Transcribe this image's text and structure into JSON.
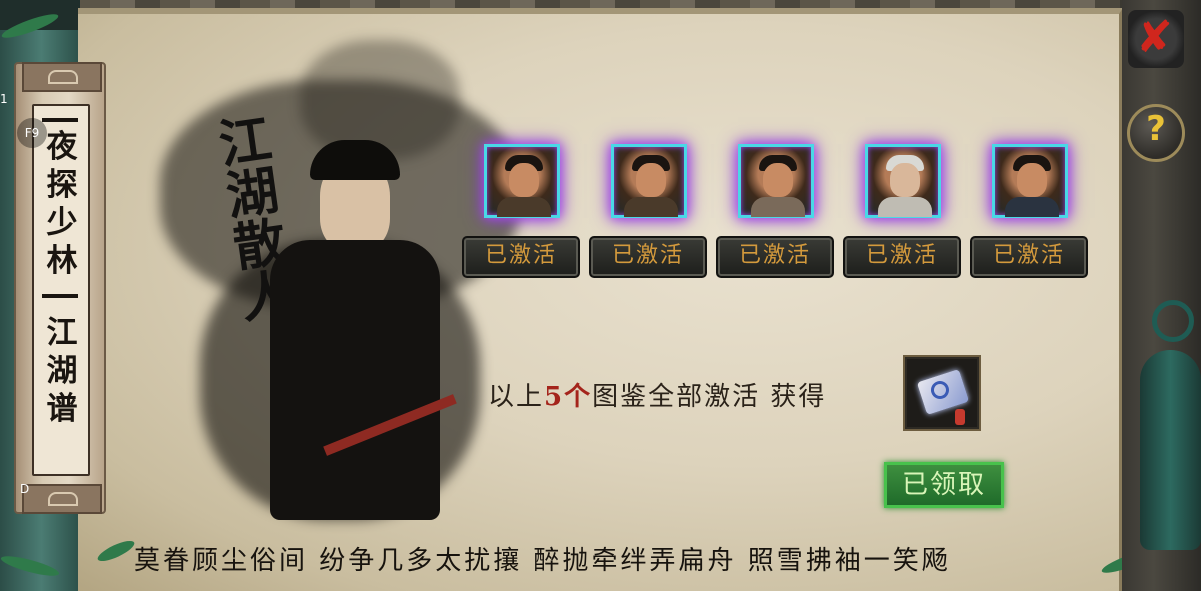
{
  "side_marks": {
    "top": "1",
    "hotkey": "F9",
    "bottom": "D"
  },
  "banner": {
    "title_chars": [
      "夜",
      "探",
      "少",
      "林"
    ],
    "subtitle_chars": [
      "江",
      "湖",
      "谱"
    ]
  },
  "painting": {
    "calligraphy_chars": [
      "江",
      "湖",
      "散",
      "人"
    ]
  },
  "heroes": [
    {
      "name": "hero-1",
      "status_label": "已激活"
    },
    {
      "name": "hero-2",
      "status_label": "已激活"
    },
    {
      "name": "hero-3",
      "status_label": "已激活"
    },
    {
      "name": "hero-4",
      "status_label": "已激活"
    },
    {
      "name": "hero-5",
      "status_label": "已激活"
    }
  ],
  "reward": {
    "prefix": "以上",
    "count": "5个",
    "suffix": "图鉴全部激活 获得",
    "item_icon": "scroll-icon"
  },
  "claim_button": {
    "label": "已领取"
  },
  "poem": "莫眷顾尘俗间 纷争几多太扰攘 醉抛牵绊弄扁舟 照雪拂袖一笑飏",
  "controls": {
    "close_icon": "close-icon",
    "help_label": "?"
  },
  "colors": {
    "portrait_border": "#49d8e6",
    "portrait_glow": "#b04ff0",
    "activate_text": "#d49a3c",
    "claimed_green": "#2f8a35",
    "count_red": "#a4241b"
  }
}
